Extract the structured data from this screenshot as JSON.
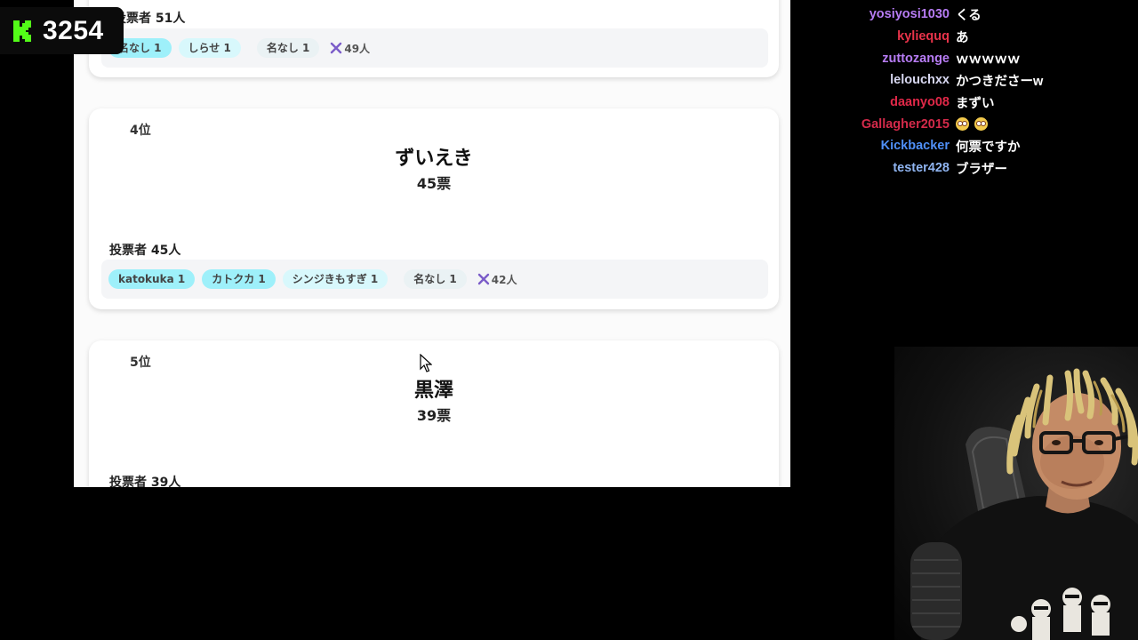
{
  "stream": {
    "viewer_count": "3254",
    "logo_color": "#53fc18"
  },
  "top_card": {
    "voters": "投票者 51人",
    "tags": [
      "名なし 1",
      "しらせ 1",
      "名なし 1"
    ],
    "more": "49人"
  },
  "card4": {
    "rank": "4位",
    "name": "ずいえき",
    "votes": "45票",
    "voters": "投票者 45人",
    "tags": [
      "katokuka 1",
      "カトクカ 1",
      "シンジきもすぎ 1",
      "名なし 1"
    ],
    "more": "42人"
  },
  "card5": {
    "rank": "5位",
    "name": "黒澤",
    "votes": "39票",
    "voters": "投票者 39人"
  },
  "chat": [
    {
      "user": "yosiyosi1030",
      "color": "#b77cf4",
      "message": "くる"
    },
    {
      "user": "kyliequq",
      "color": "#e8334a",
      "message": "あ"
    },
    {
      "user": "zuttozange",
      "color": "#b77cf4",
      "message": "ｗｗｗｗｗ"
    },
    {
      "user": "lelouchxx",
      "color": "#d7d7f0",
      "message": "かつきださーw"
    },
    {
      "user": "daanyo08",
      "color": "#e02848",
      "message": "まずい"
    },
    {
      "user": "Gallagher2015",
      "color": "#d42a4a",
      "message": ""
    },
    {
      "user": "Kickbacker",
      "color": "#4f8ff7",
      "message": "何票ですか"
    },
    {
      "user": "tester428",
      "color": "#8fb4f0",
      "message": "ブラザー"
    }
  ]
}
